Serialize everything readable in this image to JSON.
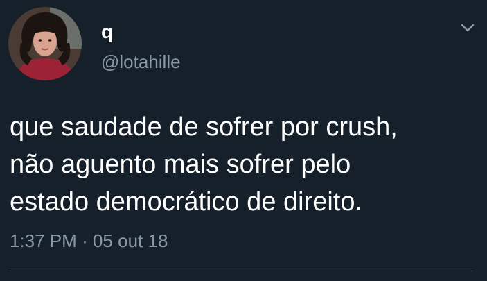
{
  "author": {
    "display_name": "q",
    "handle": "@lotahille",
    "avatar_icon": "profile-photo"
  },
  "menu": {
    "icon": "chevron-down-icon"
  },
  "tweet": {
    "lines": [
      "que saudade de sofrer por crush,",
      "não aguento mais sofrer pelo",
      "estado democrático de direito."
    ],
    "time": "1:37 PM",
    "separator": "·",
    "date": "05 out 18"
  },
  "colors": {
    "background": "#15202b",
    "primary_text": "#ffffff",
    "secondary_text": "#8899a6",
    "divider": "#38444d"
  }
}
